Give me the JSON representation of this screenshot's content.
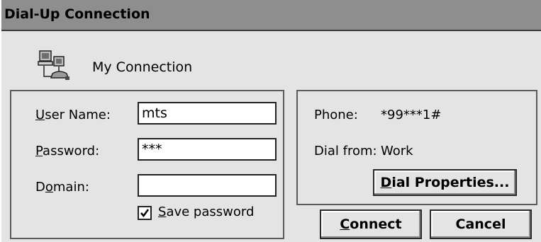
{
  "window": {
    "title": "Dial-Up Connection"
  },
  "connection": {
    "name": "My Connection",
    "icon": "network-connection-icon"
  },
  "credentials": {
    "username_label_accel": "U",
    "username_label_rest": "ser Name:",
    "username_value": "mts",
    "password_label_accel": "P",
    "password_label_rest": "assword:",
    "password_value": "***",
    "domain_label_pre": "D",
    "domain_label_accel": "o",
    "domain_label_rest": "main:",
    "domain_value": "",
    "save_password_accel": "S",
    "save_password_rest": "ave password",
    "save_password_checked": true
  },
  "dial_info": {
    "phone_label": "Phone:",
    "phone_value": "*99***1#",
    "dial_from_label": "Dial from:",
    "dial_from_value": "Work",
    "dial_properties_accel": "D",
    "dial_properties_rest": "ial Properties..."
  },
  "buttons": {
    "connect_accel": "C",
    "connect_rest": "onnect",
    "cancel_label": "Cancel"
  }
}
